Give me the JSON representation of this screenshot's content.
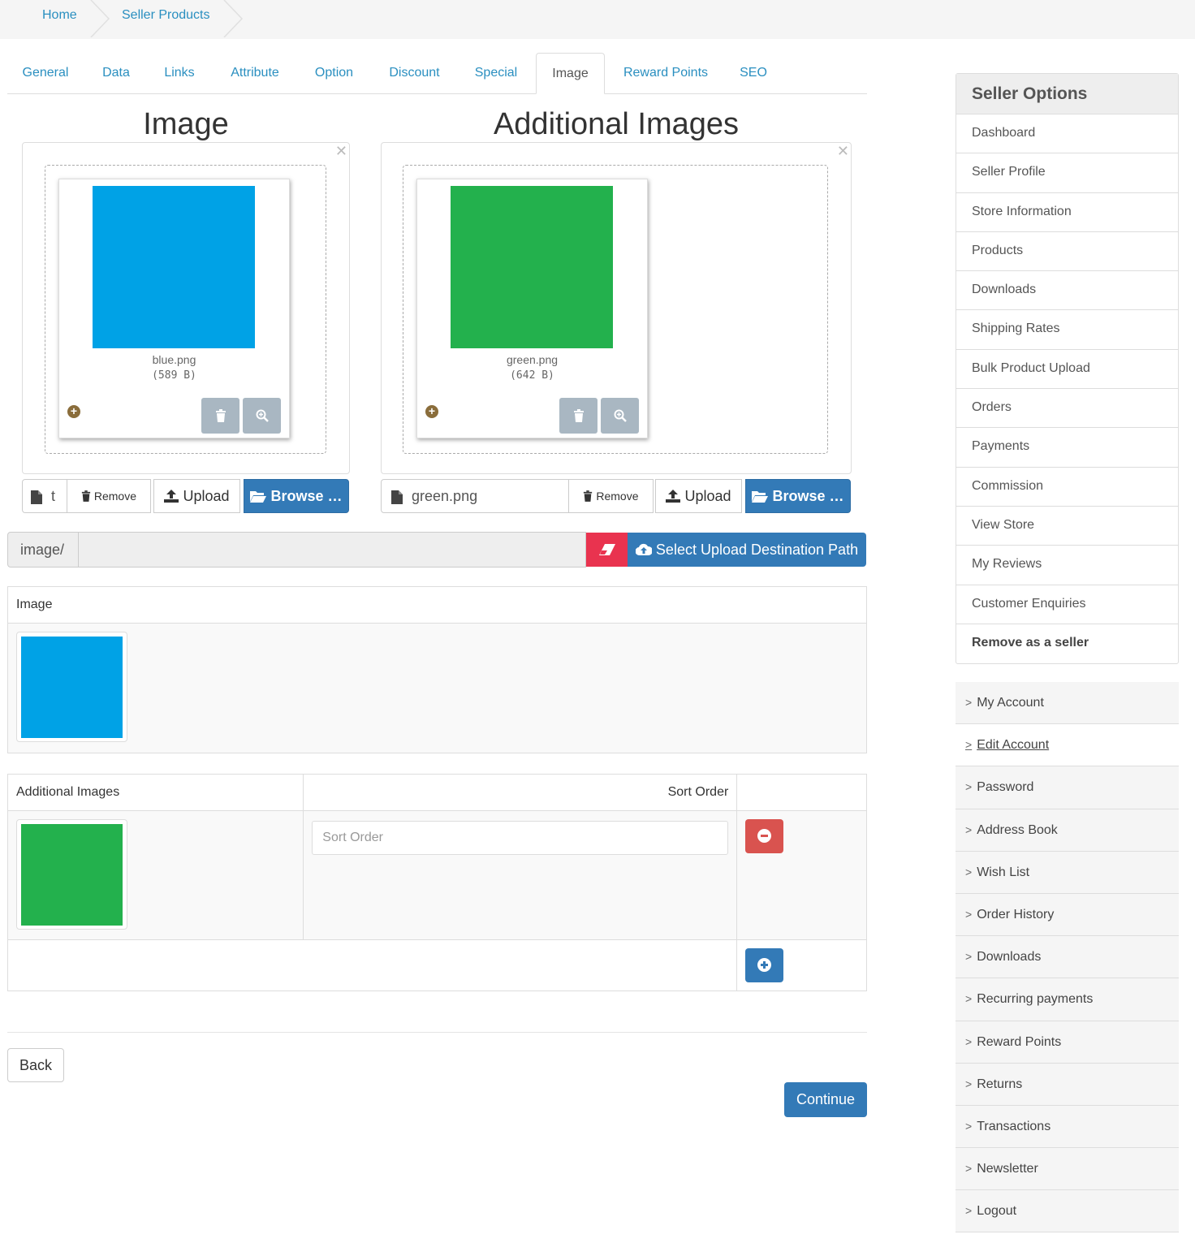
{
  "breadcrumb": {
    "home": "Home",
    "current": "Seller Products"
  },
  "tabs": [
    "General",
    "Data",
    "Links",
    "Attribute",
    "Option",
    "Discount",
    "Special",
    "Image",
    "Reward Points",
    "SEO"
  ],
  "active_tab": "Image",
  "image_section": {
    "title": "Image",
    "file_name": "blue.png",
    "file_size": "(589 B)",
    "caption_text": "t",
    "color": "#00a2e6"
  },
  "additional_section": {
    "title": "Additional Images",
    "file_name": "green.png",
    "file_size": "(642 B)",
    "caption_text": "green.png",
    "color": "#23b14d"
  },
  "buttons": {
    "remove": "Remove",
    "upload": "Upload",
    "browse": "Browse …",
    "select_path": "Select Upload Destination Path",
    "back": "Back",
    "continue": "Continue"
  },
  "path": {
    "prefix": "image/"
  },
  "image_table": {
    "header": "Image"
  },
  "additional_table": {
    "header_images": "Additional Images",
    "header_sort": "Sort Order",
    "sort_placeholder": "Sort Order"
  },
  "seller_options": {
    "title": "Seller Options",
    "items": [
      "Dashboard",
      "Seller Profile",
      "Store Information",
      "Products",
      "Downloads",
      "Shipping Rates",
      "Bulk Product Upload",
      "Orders",
      "Payments",
      "Commission",
      "View Store",
      "My Reviews",
      "Customer Enquiries",
      "Remove as a seller"
    ]
  },
  "account_links": [
    "My Account",
    "Edit Account",
    "Password",
    "Address Book",
    "Wish List",
    "Order History",
    "Downloads",
    "Recurring payments",
    "Reward Points",
    "Returns",
    "Transactions",
    "Newsletter",
    "Logout"
  ],
  "colors": {
    "link": "#2a8fc0",
    "primary": "#337ab7",
    "danger": "#d9534f",
    "clear": "#e9334f"
  }
}
